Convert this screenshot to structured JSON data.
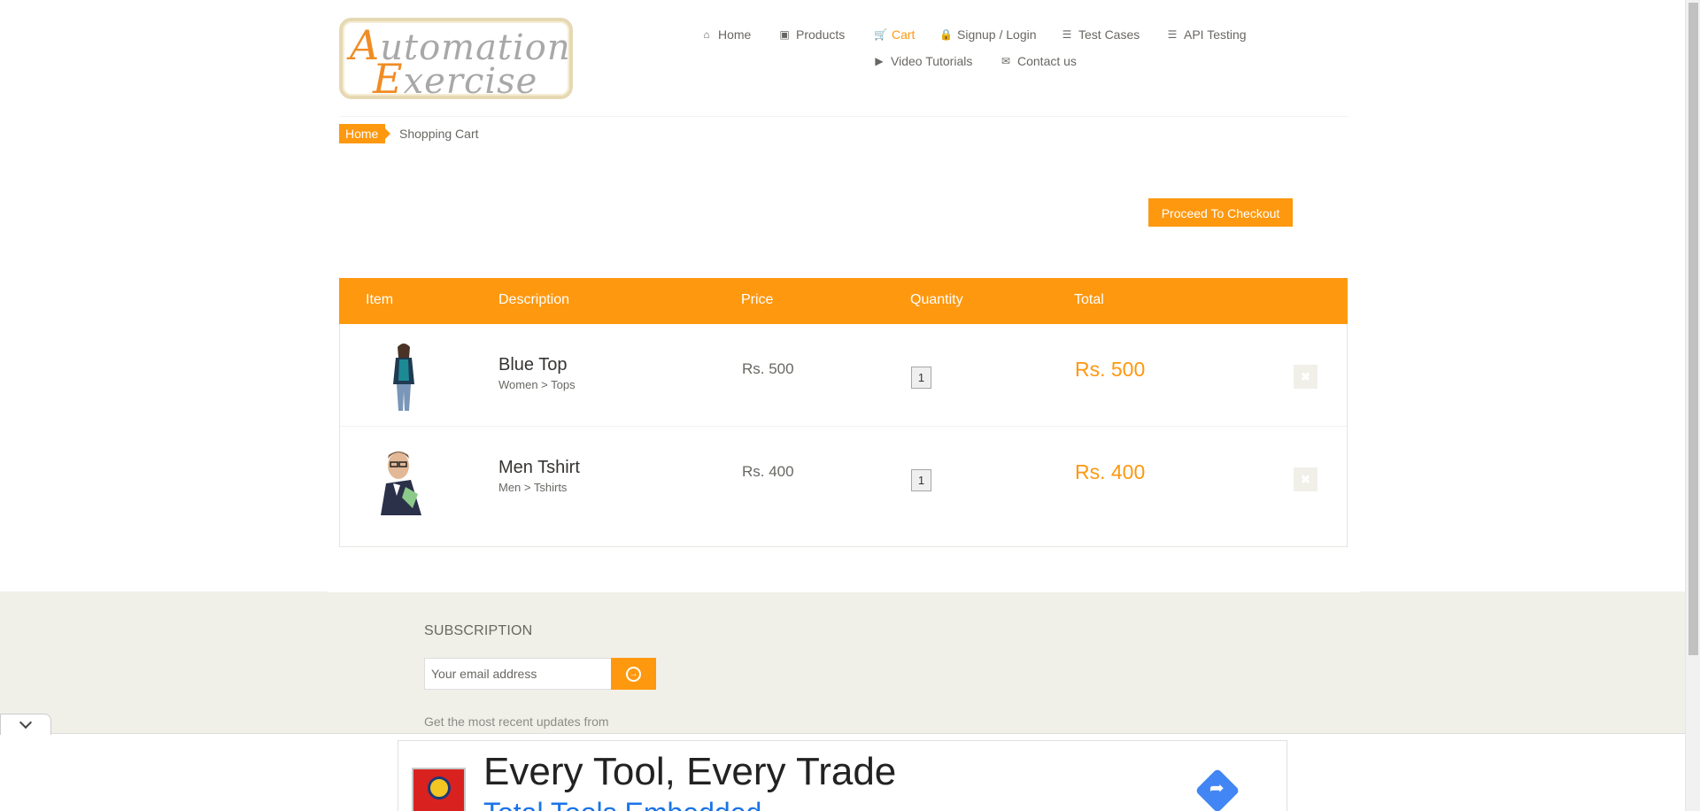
{
  "logo": {
    "line1_cap": "A",
    "line1_rest": "utomation",
    "line2_cap": "E",
    "line2_rest": "xercise"
  },
  "nav": [
    {
      "label": "Home",
      "icon": "home-icon",
      "glyph": "⌂",
      "active": false
    },
    {
      "label": "Products",
      "icon": "briefcase-icon",
      "glyph": "▣",
      "active": false
    },
    {
      "label": "Cart",
      "icon": "cart-icon",
      "glyph": "🛒",
      "active": true
    },
    {
      "label": "Signup / Login",
      "icon": "lock-icon",
      "glyph": "🔒",
      "active": false
    },
    {
      "label": "Test Cases",
      "icon": "list-icon",
      "glyph": "☰",
      "active": false
    },
    {
      "label": "API Testing",
      "icon": "list-icon",
      "glyph": "☰",
      "active": false
    },
    {
      "label": "Video Tutorials",
      "icon": "youtube-icon",
      "glyph": "▶",
      "active": false
    },
    {
      "label": "Contact us",
      "icon": "envelope-icon",
      "glyph": "✉",
      "active": false
    }
  ],
  "breadcrumb": {
    "home": "Home",
    "current": "Shopping Cart"
  },
  "checkout_label": "Proceed To Checkout",
  "cart": {
    "headers": {
      "item": "Item",
      "description": "Description",
      "price": "Price",
      "quantity": "Quantity",
      "total": "Total"
    },
    "rows": [
      {
        "name": "Blue Top",
        "category": "Women > Tops",
        "price": "Rs. 500",
        "quantity": "1",
        "total": "Rs. 500",
        "delete_glyph": "✖"
      },
      {
        "name": "Men Tshirt",
        "category": "Men > Tshirts",
        "price": "Rs. 400",
        "quantity": "1",
        "total": "Rs. 400",
        "delete_glyph": "✖"
      }
    ]
  },
  "footer": {
    "subscription_title": "SUBSCRIPTION",
    "email_placeholder": "Your email address",
    "subscribe_glyph": "→",
    "note": "Get the most recent updates from"
  },
  "ad": {
    "headline": "Every Tool, Every Trade",
    "subline": "Total Tools Embedded"
  },
  "colors": {
    "accent": "#fe980f",
    "footer_bg": "#f0f0e9",
    "text": "#696763"
  }
}
